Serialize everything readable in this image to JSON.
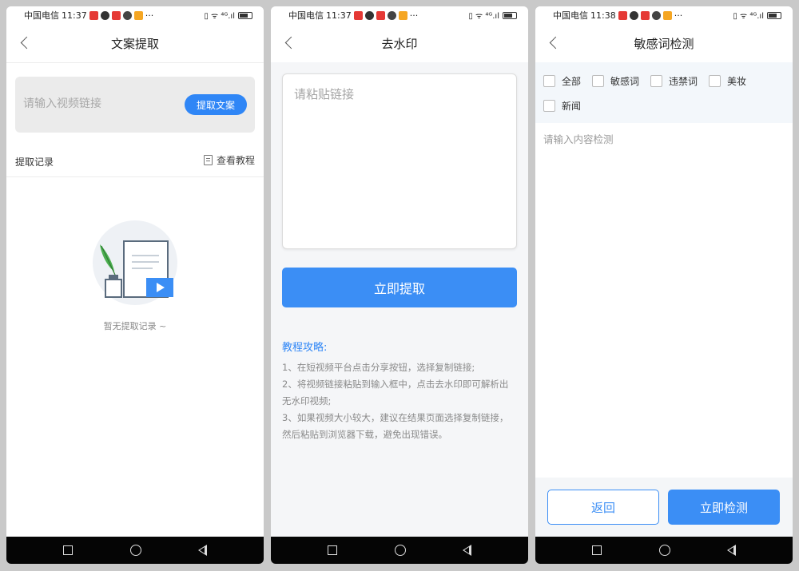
{
  "statusbar": {
    "carrier": "中国电信",
    "time1": "11:37",
    "time2": "11:37",
    "time3": "11:38",
    "right_icons": "▯ ᯤ ⁴ᴳ.ıl",
    "app_icon_colors": [
      "#e53935",
      "#333333",
      "#e53935",
      "#333333",
      "#f5a623"
    ]
  },
  "screen1": {
    "title": "文案提取",
    "input_placeholder": "请输入视频链接",
    "extract_button": "提取文案",
    "records_label": "提取记录",
    "tutorial_link": "查看教程",
    "empty_text": "暂无提取记录 ~"
  },
  "screen2": {
    "title": "去水印",
    "paste_placeholder": "请粘贴链接",
    "extract_now_button": "立即提取",
    "guide_title": "教程攻略:",
    "guide_steps": [
      "1、在短视频平台点击分享按钮，选择复制链接;",
      "2、将视频链接粘贴到输入框中，点击去水印即可解析出无水印视频;",
      "3、如果视频大小较大，建议在结果页面选择复制链接，然后粘贴到浏览器下载，避免出现错误。"
    ]
  },
  "screen3": {
    "title": "敏感词检测",
    "filters": [
      "全部",
      "敏感词",
      "违禁词",
      "美妆",
      "新闻"
    ],
    "content_placeholder": "请输入内容检测",
    "back_button": "返回",
    "detect_button": "立即检测"
  },
  "colors": {
    "accent": "#3b8ef5",
    "nav_bar": "#050505"
  }
}
